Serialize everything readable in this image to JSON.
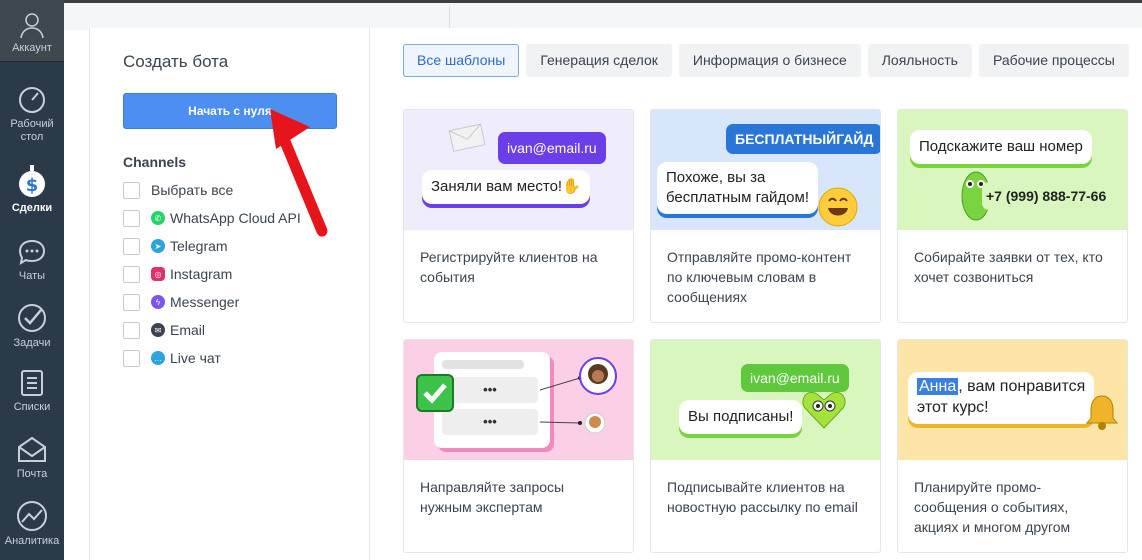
{
  "sidebar": {
    "items": [
      {
        "label": "Аккаунт",
        "icon": "account-icon"
      },
      {
        "label": "Рабочий стол",
        "icon": "dashboard-icon"
      },
      {
        "label": "Сделки",
        "icon": "deals-icon"
      },
      {
        "label": "Чаты",
        "icon": "chat-icon"
      },
      {
        "label": "Задачи",
        "icon": "tasks-icon"
      },
      {
        "label": "Списки",
        "icon": "lists-icon"
      },
      {
        "label": "Почта",
        "icon": "mail-icon"
      },
      {
        "label": "Аналитика",
        "icon": "analytics-icon"
      }
    ]
  },
  "modal": {
    "title": "Создать бота",
    "start_button": "Начать с нуля",
    "channels_heading": "Channels",
    "channels": [
      {
        "label": "Выбрать все"
      },
      {
        "label": "WhatsApp Cloud API",
        "icon": "whatsapp-icon",
        "color": "#25d366"
      },
      {
        "label": "Telegram",
        "icon": "telegram-icon",
        "color": "#2aa3df"
      },
      {
        "label": "Instagram",
        "icon": "instagram-icon",
        "color": "#e1306c"
      },
      {
        "label": "Messenger",
        "icon": "messenger-icon",
        "color": "#7b54f2"
      },
      {
        "label": "Email",
        "icon": "email-icon",
        "color": "#3b4450"
      },
      {
        "label": "Live чат",
        "icon": "live-chat-icon",
        "color": "#2aa3df"
      }
    ]
  },
  "tabs": [
    "Все шаблоны",
    "Генерация сделок",
    "Информация о бизнесе",
    "Лояльность",
    "Рабочие процессы"
  ],
  "cards": [
    {
      "bubble_tag": "ivan@email.ru",
      "bubble_text": "Заняли вам место!",
      "description": "Регистрируйте клиентов на события"
    },
    {
      "bubble_tag": "БЕСПЛАТНЫЙГАЙД",
      "bubble_line1": "Похоже, вы за",
      "bubble_line2": "бесплатным гайдом!",
      "description": "Отправляйте промо-контент по ключевым словам в сообщениях"
    },
    {
      "bubble_text": "Подскажите ваш номер",
      "bubble_tag": "+7 (999) 888-77-66",
      "description": "Собирайте заявки от тех, кто хочет созвониться"
    },
    {
      "dots": "•••",
      "description": "Направляйте запросы нужным экспертам"
    },
    {
      "bubble_tag": "ivan@email.ru",
      "bubble_text": "Вы подписаны!",
      "description": "Подписывайте клиентов на новостную рассылку по email"
    },
    {
      "name_highlight": "Анна",
      "bubble_rest": ", вам понравится",
      "bubble_line2": "этот курс!",
      "description": "Планируйте промо-сообщения о событиях, акциях и многом другом"
    }
  ],
  "colors": {
    "sidebar_bg": "#2a3a48",
    "primary_button": "#4c8ff0",
    "active_tab_border": "#7aa9ea",
    "arrow": "#e8141c"
  }
}
